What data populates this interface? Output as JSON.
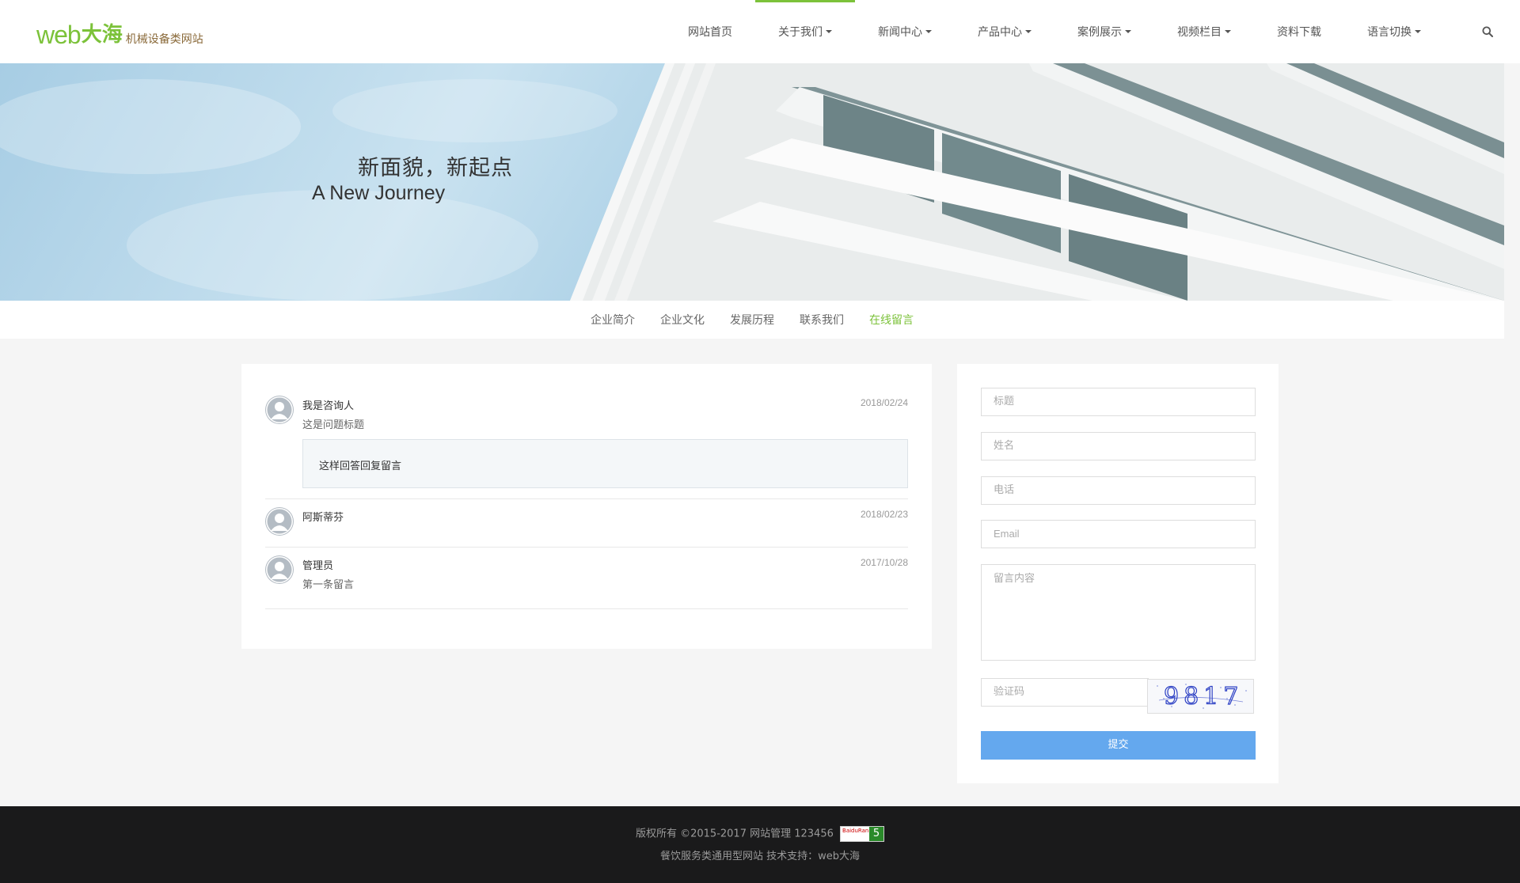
{
  "logo": {
    "web": "web",
    "dahai": "大海",
    "subtitle": "机械设备类网站"
  },
  "nav": {
    "items": [
      {
        "label": "网站首页",
        "dropdown": false,
        "active": false
      },
      {
        "label": "关于我们",
        "dropdown": true,
        "active": true
      },
      {
        "label": "新闻中心",
        "dropdown": true,
        "active": false
      },
      {
        "label": "产品中心",
        "dropdown": true,
        "active": false
      },
      {
        "label": "案例展示",
        "dropdown": true,
        "active": false
      },
      {
        "label": "视频栏目",
        "dropdown": true,
        "active": false
      },
      {
        "label": "资料下载",
        "dropdown": false,
        "active": false
      },
      {
        "label": "语言切换",
        "dropdown": true,
        "active": false
      }
    ],
    "search_icon": "search-icon"
  },
  "banner": {
    "cn": "新面貌，新起点",
    "en": "A New Journey"
  },
  "subnav": {
    "items": [
      {
        "label": "企业简介",
        "active": false
      },
      {
        "label": "企业文化",
        "active": false
      },
      {
        "label": "发展历程",
        "active": false
      },
      {
        "label": "联系我们",
        "active": false
      },
      {
        "label": "在线留言",
        "active": true
      }
    ]
  },
  "messages": [
    {
      "name": "我是咨询人",
      "text": "这是问题标题",
      "date": "2018/02/24",
      "reply": "这样回答回复留言"
    },
    {
      "name": "阿斯蒂芬",
      "text": "",
      "date": "2018/02/23",
      "reply": ""
    },
    {
      "name": "管理员",
      "text": "第一条留言",
      "date": "2017/10/28",
      "reply": ""
    }
  ],
  "form": {
    "title_placeholder": "标题",
    "name_placeholder": "姓名",
    "phone_placeholder": "电话",
    "email_placeholder": "Email",
    "content_placeholder": "留言内容",
    "captcha_placeholder": "验证码",
    "captcha_code": "9817",
    "submit_label": "提交"
  },
  "footer": {
    "line1": "版权所有 ©2015-2017 网站管理 123456",
    "rank_label": "BaiduRank",
    "rank_value": "5",
    "line2": "餐饮服务类通用型网站 技术支持：web大海"
  },
  "colors": {
    "accent": "#7cc23a",
    "submit": "#64a8ee",
    "footer_bg": "#1a1a1b"
  }
}
